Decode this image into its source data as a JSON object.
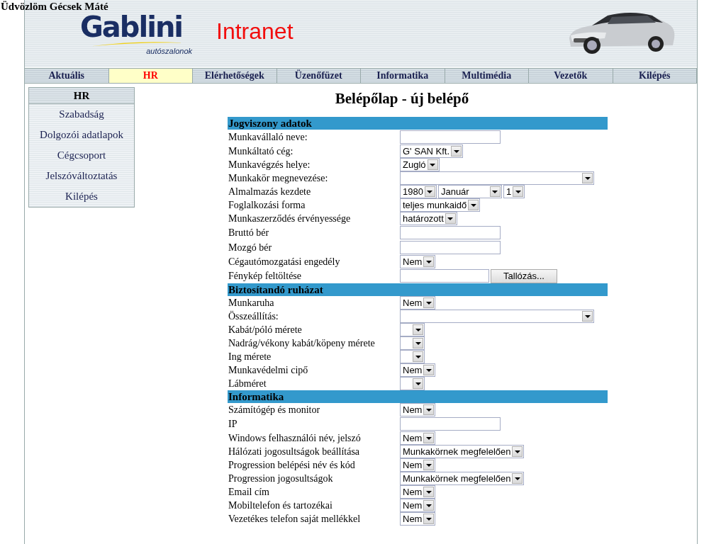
{
  "greeting": "Üdvözlöm Gécsek Máté",
  "logo": {
    "name": "Gablini",
    "tagline": "autószalonok"
  },
  "site_title": "Intranet",
  "nav": [
    {
      "label": "Aktuális",
      "selected": false
    },
    {
      "label": "HR",
      "selected": true
    },
    {
      "label": "Elérhetőségek",
      "selected": false
    },
    {
      "label": "Üzenőfüzet",
      "selected": false
    },
    {
      "label": "Informatika",
      "selected": false
    },
    {
      "label": "Multimédia",
      "selected": false
    },
    {
      "label": "Vezetők",
      "selected": false
    },
    {
      "label": "Kilépés",
      "selected": false
    }
  ],
  "sidebar": {
    "title": "HR",
    "items": [
      "Szabadság",
      "Dolgozói adatlapok",
      "Cégcsoport",
      "Jelszóváltoztatás",
      "Kilépés"
    ]
  },
  "page_title": "Belépőlap - új belépő",
  "sections": [
    {
      "title": "Jogviszony adatok",
      "rows": [
        {
          "label": "Munkavállaló neve:",
          "kind": "text"
        },
        {
          "label": "Munkáltató cég:",
          "kind": "select",
          "value": "G' SAN Kft."
        },
        {
          "label": "Munkavégzés helye:",
          "kind": "select",
          "value": "Zugló"
        },
        {
          "label": "Munkakör megnevezése:",
          "kind": "wide"
        },
        {
          "label": "Almalmazás kezdete",
          "kind": "date",
          "value": [
            "1980",
            "Január",
            "1"
          ]
        },
        {
          "label": "Foglalkozási forma",
          "kind": "select",
          "value": "teljes munkaidő"
        },
        {
          "label": "Munkaszerződés érvényessége",
          "kind": "select",
          "value": "határozott"
        },
        {
          "label": "Bruttó bér",
          "kind": "text"
        },
        {
          "label": "Mozgó bér",
          "kind": "text"
        },
        {
          "label": "Cégautómozgatási engedély",
          "kind": "select",
          "value": "Nem"
        },
        {
          "label": "Fénykép feltöltése",
          "kind": "file",
          "button": "Tallózás..."
        }
      ]
    },
    {
      "title": "Biztosítandó ruházat",
      "rows": [
        {
          "label": "Munkaruha",
          "kind": "select",
          "value": "Nem"
        },
        {
          "label": "Összeállítás:",
          "kind": "wide"
        },
        {
          "label": "Kabát/póló mérete",
          "kind": "select"
        },
        {
          "label": "Nadrág/vékony kabát/köpeny mérete",
          "kind": "select"
        },
        {
          "label": "Ing mérete",
          "kind": "select"
        },
        {
          "label": "Munkavédelmi cipő",
          "kind": "select",
          "value": "Nem"
        },
        {
          "label": "Lábméret",
          "kind": "select"
        }
      ]
    },
    {
      "title": "Informatika",
      "rows": [
        {
          "label": "Számítógép és monitor",
          "kind": "select",
          "value": "Nem"
        },
        {
          "label": "IP",
          "kind": "text"
        },
        {
          "label": "Windows felhasználói név, jelszó",
          "kind": "select",
          "value": "Nem"
        },
        {
          "label": "Hálózati jogosultságok beállítása",
          "kind": "select",
          "value": "Munkakörnek megfelelően"
        },
        {
          "label": "Progression belépési név és kód",
          "kind": "select",
          "value": "Nem"
        },
        {
          "label": "Progression jogosultságok",
          "kind": "select",
          "value": "Munkakörnek megfelelően"
        },
        {
          "label": "Email cím",
          "kind": "select",
          "value": "Nem"
        },
        {
          "label": "Mobiltelefon és tartozékai",
          "kind": "select",
          "value": "Nem"
        },
        {
          "label": "Vezetékes telefon saját mellékkel",
          "kind": "select",
          "value": "Nem"
        }
      ]
    }
  ]
}
